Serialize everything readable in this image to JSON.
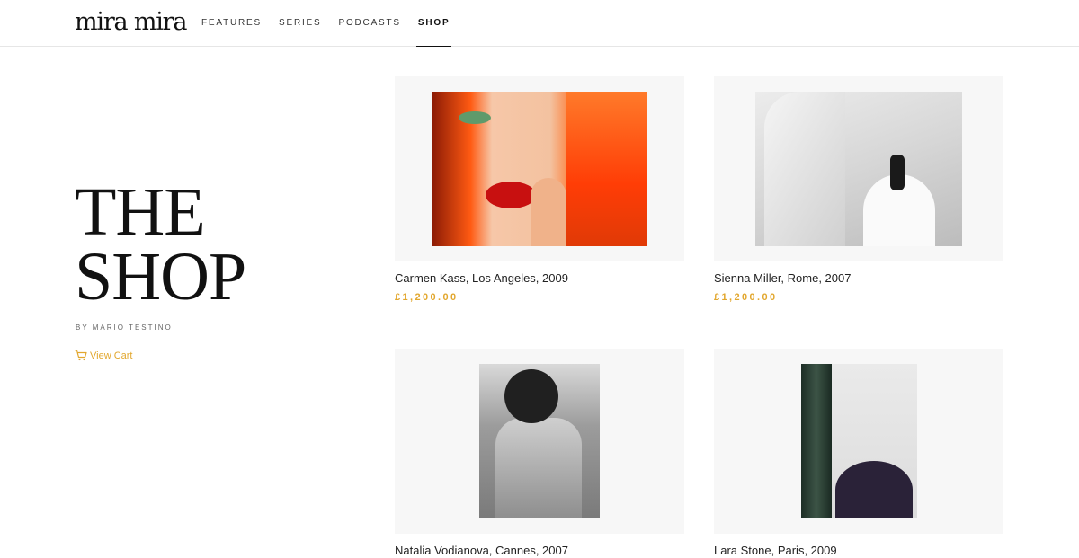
{
  "header": {
    "logo": "mira mira",
    "nav": [
      "FEATURES",
      "SERIES",
      "PODCASTS",
      "SHOP"
    ],
    "active": "SHOP"
  },
  "hero": {
    "line1": "THE",
    "line2": "SHOP",
    "byline": "BY MARIO TESTINO",
    "cart_label": "View Cart",
    "cart_icon": "cart-icon"
  },
  "colors": {
    "accent": "#e2a72e",
    "text": "#111111",
    "card_bg": "#f7f7f7"
  },
  "products": [
    {
      "name": "Carmen Kass, Los Angeles, 2009",
      "price": "£1,200.00"
    },
    {
      "name": "Sienna Miller, Rome, 2007",
      "price": "£1,200.00"
    },
    {
      "name": "Natalia Vodianova, Cannes, 2007",
      "price": ""
    },
    {
      "name": "Lara Stone, Paris, 2009",
      "price": ""
    }
  ]
}
